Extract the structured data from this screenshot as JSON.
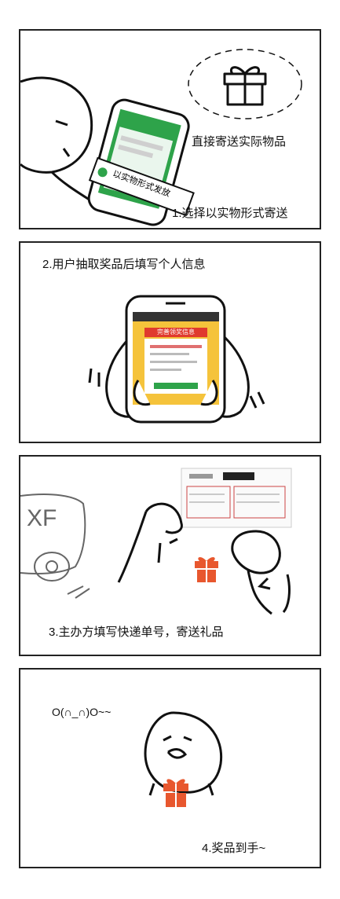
{
  "panels": [
    {
      "caption": "1.选择以实物形式寄送",
      "gift_label": "直接寄送实际物品",
      "phone_tag": "以实物形式发放"
    },
    {
      "caption": "2.用户抽取奖品后填写个人信息",
      "form_header": "完善领奖信息"
    },
    {
      "caption": "3.主办方填写快递单号，寄送礼品",
      "scribble": "XF"
    },
    {
      "caption": "4.奖品到手~",
      "emoticon": "O(∩_∩)O~~"
    }
  ],
  "colors": {
    "gift": "#e8572e",
    "phone_screen": "#2ea34a",
    "form_bg": "#f5c33b",
    "form_header": "#e03a2e"
  }
}
